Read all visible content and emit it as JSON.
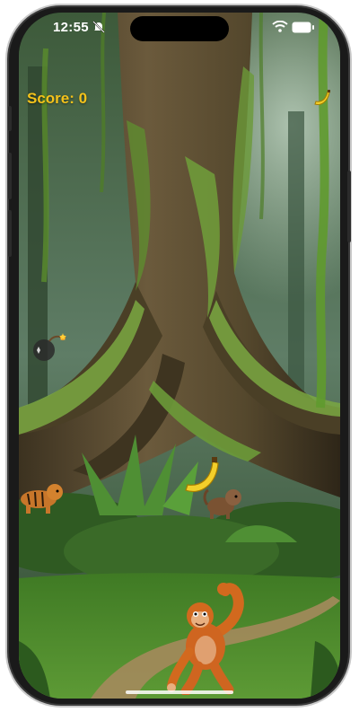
{
  "status_bar": {
    "time": "12:55",
    "icons": [
      "bell-slash-icon",
      "wifi-icon",
      "battery-icon"
    ]
  },
  "hud": {
    "score_text": "Score: 0",
    "lives_icons": [
      "banana-icon"
    ]
  },
  "colors": {
    "score": "#f4c21a",
    "banana": "#f3cf2a",
    "orangutan": "#d2691e",
    "grass": "#4c8a2a"
  },
  "sprites": [
    "bomb",
    "banana",
    "tiger",
    "monkey",
    "orangutan-player"
  ]
}
